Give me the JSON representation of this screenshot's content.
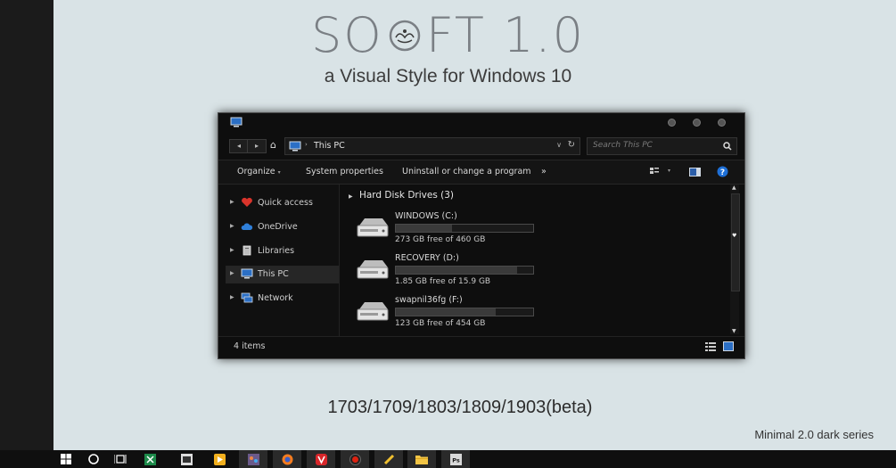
{
  "hero": {
    "title_left": "SO",
    "title_right": "FT 1.0",
    "subtitle": "a Visual Style for Windows 10",
    "versions": "1703/1709/1803/1809/1903(beta)",
    "series": "Minimal 2.0 dark series"
  },
  "explorer": {
    "address": {
      "crumb": "This PC"
    },
    "search": {
      "placeholder": "Search This PC"
    },
    "commands": {
      "organize": "Organize",
      "system_properties": "System properties",
      "uninstall": "Uninstall or change a program",
      "more": "»"
    },
    "sidebar": {
      "items": [
        {
          "label": "Quick access",
          "icon": "heart-icon"
        },
        {
          "label": "OneDrive",
          "icon": "cloud-icon"
        },
        {
          "label": "Libraries",
          "icon": "library-icon"
        },
        {
          "label": "This PC",
          "icon": "computer-icon",
          "selected": true
        },
        {
          "label": "Network",
          "icon": "network-icon"
        }
      ]
    },
    "group_heading": "Hard Disk Drives (3)",
    "drives": [
      {
        "name": "WINDOWS (C:)",
        "free": "273 GB free of 460 GB",
        "used_fraction": 0.41
      },
      {
        "name": "RECOVERY (D:)",
        "free": "1.85 GB free of 15.9 GB",
        "used_fraction": 0.88
      },
      {
        "name": "swapnil36fg (F:)",
        "free": "123 GB free of 454 GB",
        "used_fraction": 0.73
      }
    ],
    "status": {
      "count": "4 items"
    }
  },
  "colors": {
    "window_bg": "#0e0e0e",
    "page_bg": "#d9e3e6",
    "help_blue": "#1e6fd6",
    "heart_red": "#d9342b"
  }
}
